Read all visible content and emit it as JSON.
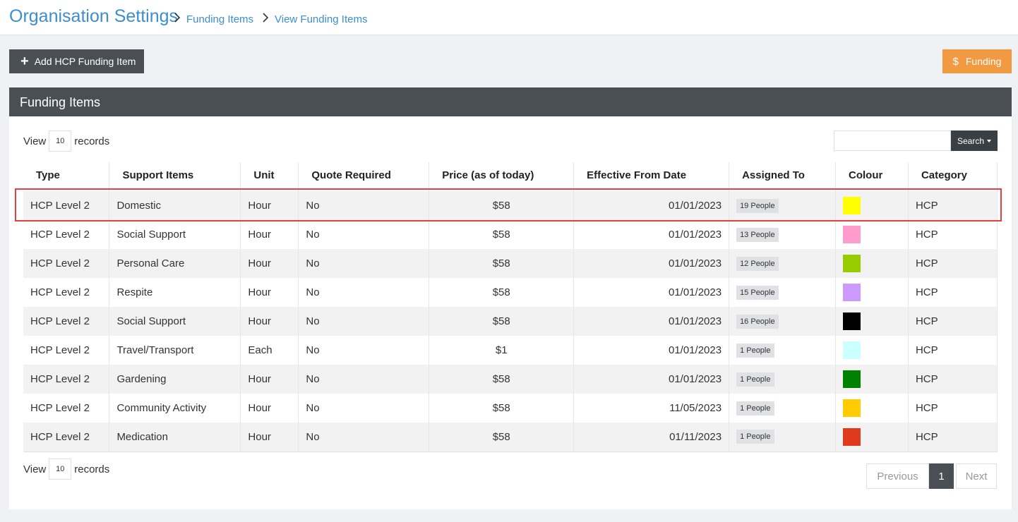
{
  "breadcrumb": {
    "title": "Organisation Settings",
    "link1": "Funding Items",
    "link2": "View Funding Items"
  },
  "toolbar": {
    "add_label": "Add HCP Funding Item",
    "funding_label": "Funding"
  },
  "panel": {
    "title": "Funding Items",
    "view_label": "View",
    "records_label": "records",
    "page_size": "10",
    "search_label": "Search",
    "search_value": ""
  },
  "table": {
    "columns": [
      "Type",
      "Support Items",
      "Unit",
      "Quote Required",
      "Price (as of today)",
      "Effective From Date",
      "Assigned To",
      "Colour",
      "Category"
    ],
    "rows": [
      {
        "type": "HCP Level 2",
        "item": "Domestic",
        "unit": "Hour",
        "quote": "No",
        "price": "$58",
        "date": "01/01/2023",
        "assigned": "19 People",
        "colour": "#ffff00",
        "category": "HCP"
      },
      {
        "type": "HCP Level 2",
        "item": "Social Support",
        "unit": "Hour",
        "quote": "No",
        "price": "$58",
        "date": "01/01/2023",
        "assigned": "13 People",
        "colour": "#ff9ccc",
        "category": "HCP"
      },
      {
        "type": "HCP Level 2",
        "item": "Personal Care",
        "unit": "Hour",
        "quote": "No",
        "price": "$58",
        "date": "01/01/2023",
        "assigned": "12 People",
        "colour": "#99cc00",
        "category": "HCP"
      },
      {
        "type": "HCP Level 2",
        "item": "Respite",
        "unit": "Hour",
        "quote": "No",
        "price": "$58",
        "date": "01/01/2023",
        "assigned": "15 People",
        "colour": "#cc99ff",
        "category": "HCP"
      },
      {
        "type": "HCP Level 2",
        "item": "Social Support",
        "unit": "Hour",
        "quote": "No",
        "price": "$58",
        "date": "01/01/2023",
        "assigned": "16 People",
        "colour": "#000000",
        "category": "HCP"
      },
      {
        "type": "HCP Level 2",
        "item": "Travel/Transport",
        "unit": "Each",
        "quote": "No",
        "price": "$1",
        "date": "01/01/2023",
        "assigned": "1 People",
        "colour": "#ccffff",
        "category": "HCP"
      },
      {
        "type": "HCP Level 2",
        "item": "Gardening",
        "unit": "Hour",
        "quote": "No",
        "price": "$58",
        "date": "01/01/2023",
        "assigned": "1 People",
        "colour": "#008000",
        "category": "HCP"
      },
      {
        "type": "HCP Level 2",
        "item": "Community Activity",
        "unit": "Hour",
        "quote": "No",
        "price": "$58",
        "date": "11/05/2023",
        "assigned": "1 People",
        "colour": "#ffcc00",
        "category": "HCP"
      },
      {
        "type": "HCP Level 2",
        "item": "Medication",
        "unit": "Hour",
        "quote": "No",
        "price": "$58",
        "date": "01/11/2023",
        "assigned": "1 People",
        "colour": "#e03a1e",
        "category": "HCP"
      }
    ]
  },
  "pagination": {
    "previous": "Previous",
    "current": "1",
    "next": "Next"
  },
  "colors": {
    "accent": "#3c8ed0",
    "dark": "#4a4f55",
    "funding": "#f19a41",
    "highlight": "#e34040"
  },
  "icons": {
    "add": "plus-icon",
    "funding": "dollar-icon",
    "separator": "chevron-right-icon"
  }
}
